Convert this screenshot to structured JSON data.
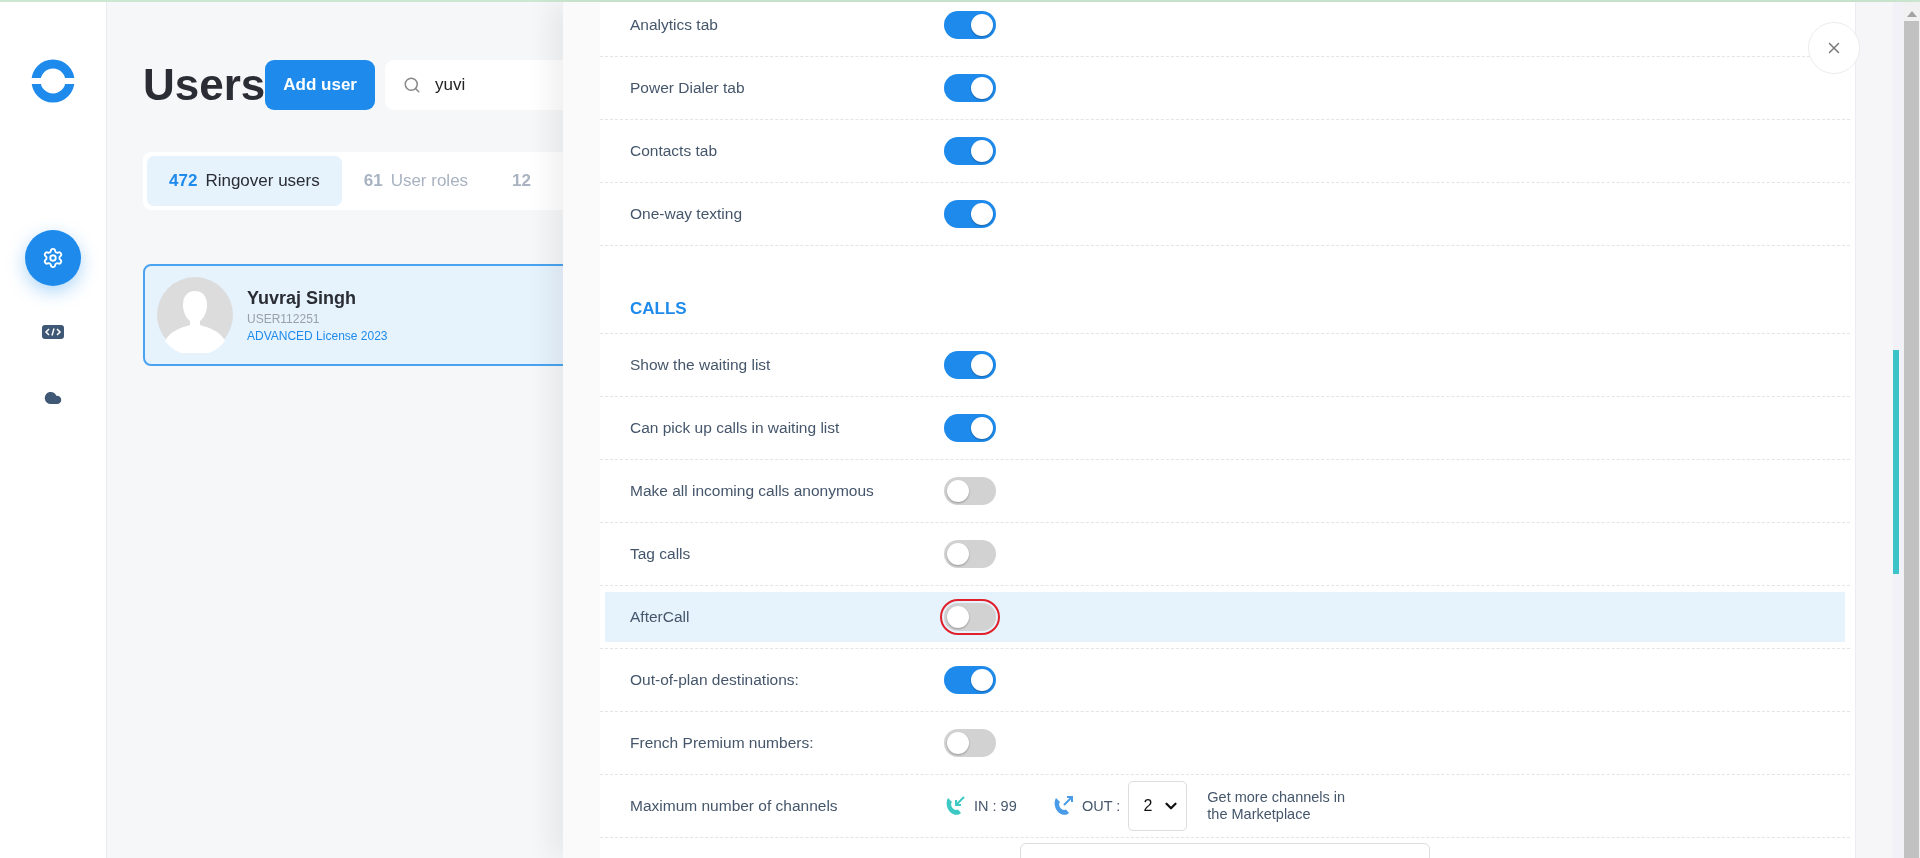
{
  "sidebar": {
    "items": [
      {
        "kind": "settings",
        "selected": true
      },
      {
        "kind": "code",
        "selected": false
      },
      {
        "kind": "cloud",
        "selected": false
      }
    ]
  },
  "page": {
    "title": "Users",
    "add_button": "Add user",
    "search": {
      "value": "yuvi"
    }
  },
  "tabs": [
    {
      "count": "472",
      "label": "Ringover users",
      "selected": true
    },
    {
      "count": "61",
      "label": "User roles",
      "selected": false
    },
    {
      "count": "12",
      "selected": false
    }
  ],
  "user_card": {
    "name": "Yuvraj Singh",
    "id": "USER112251",
    "license": "ADVANCED License 2023",
    "selected": true
  },
  "settings": [
    {
      "kind": "toggle",
      "label": "Analytics tab",
      "on": true,
      "selected": false
    },
    {
      "kind": "toggle",
      "label": "Power Dialer tab",
      "on": true,
      "selected": false
    },
    {
      "kind": "toggle",
      "label": "Contacts tab",
      "on": true,
      "selected": false
    },
    {
      "kind": "toggle",
      "label": "One-way texting",
      "on": true,
      "selected": false
    }
  ],
  "sections": [
    {
      "title": "CALLS",
      "rows": [
        {
          "kind": "toggle",
          "label": "Show the waiting list",
          "on": true,
          "selected": false
        },
        {
          "kind": "toggle",
          "label": "Can pick up calls in waiting list",
          "on": true,
          "selected": false
        },
        {
          "kind": "toggle",
          "label": "Make all incoming calls anonymous",
          "on": false,
          "selected": false
        },
        {
          "kind": "toggle",
          "label": "Tag calls",
          "on": false,
          "selected": false
        },
        {
          "kind": "toggle",
          "label": "AfterCall",
          "on": false,
          "selected": true
        },
        {
          "kind": "toggle",
          "label": "Out-of-plan destinations:",
          "on": true,
          "selected": false
        },
        {
          "kind": "toggle",
          "label": "French Premium numbers:",
          "on": false,
          "selected": false
        },
        {
          "kind": "channels",
          "label": "Maximum number of channels",
          "in_label": "IN : 99",
          "out_label": "OUT :",
          "out_value": "2",
          "note": "Get more channels in the Marketplace",
          "selected": false
        }
      ]
    }
  ]
}
